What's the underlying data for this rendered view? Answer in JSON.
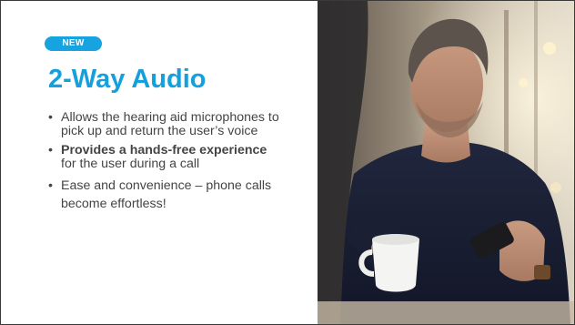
{
  "slide": {
    "badge": "NEW",
    "title": "2-Way Audio",
    "bullets": [
      {
        "text": "Allows the hearing aid microphones to pick up and return the user’s voice"
      },
      {
        "bold": "Provides a hands-free experience",
        "rest": " for the user during a call"
      },
      {
        "text": "Ease and convenience – phone calls become effortless!"
      }
    ],
    "photo": {
      "icon": "man-holding-phone-and-mug-photo"
    },
    "colors": {
      "accent": "#16a3e0",
      "title": "#14a0dc",
      "body_text": "#444444"
    }
  }
}
